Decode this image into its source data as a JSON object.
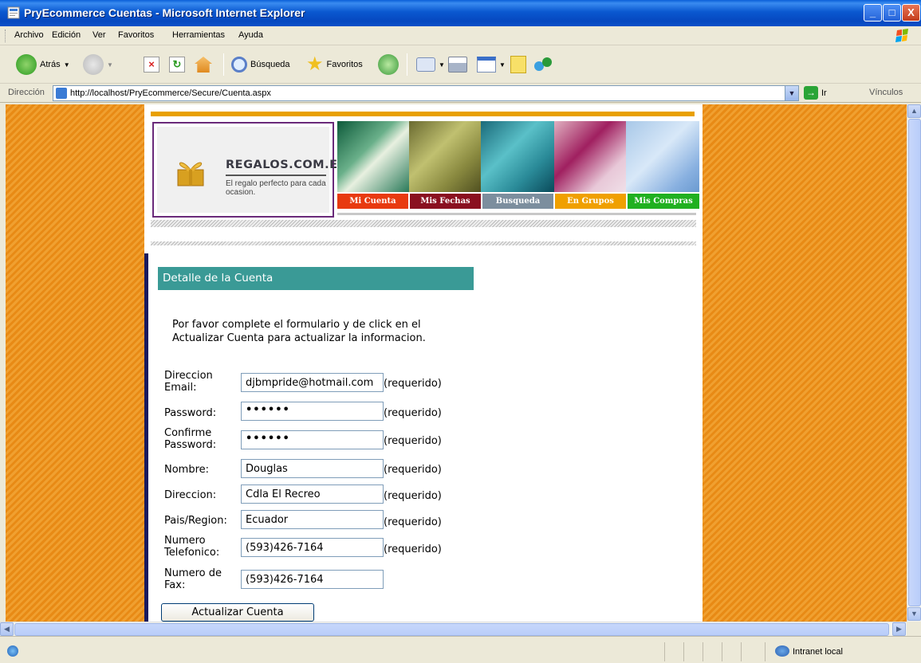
{
  "window": {
    "title": "PryEcommerce Cuentas - Microsoft Internet Explorer",
    "minimize_label": "_",
    "maximize_label": "□",
    "close_label": "X"
  },
  "menu": [
    "Archivo",
    "Edición",
    "Ver",
    "Favoritos",
    "Herramientas",
    "Ayuda"
  ],
  "toolbar": {
    "back_label": "Atrás",
    "search_label": "Búsqueda",
    "favorites_label": "Favoritos"
  },
  "address": {
    "label": "Dirección",
    "url": "http://localhost/PryEcommerce/Secure/Cuenta.aspx",
    "go_label": "Ir",
    "links_label": "Vínculos"
  },
  "site": {
    "brand": "REGALOS.COM.EC",
    "tagline": "El regalo perfecto para cada ocasion.",
    "nav": [
      {
        "label": "Mi Cuenta",
        "color": "#e83a10"
      },
      {
        "label": "Mis Fechas",
        "color": "#8a1020"
      },
      {
        "label": "Busqueda",
        "color": "#7c8e9e"
      },
      {
        "label": "En Grupos",
        "color": "#f0a000"
      },
      {
        "label": "Mis Compras",
        "color": "#20b020"
      }
    ]
  },
  "form": {
    "header": "Detalle de la Cuenta",
    "intro": "Por favor complete el formulario y de click en el Actualizar Cuenta para actualizar la informacion.",
    "required_label": "(requerido)",
    "fields": [
      {
        "label": "Direccion Email:",
        "value": "djbmpride@hotmail.com",
        "required": true
      },
      {
        "label": "Password:",
        "value": "••••••",
        "required": true
      },
      {
        "label": "Confirme Password:",
        "value": "••••••",
        "required": true
      },
      {
        "label": "Nombre:",
        "value": "Douglas",
        "required": true
      },
      {
        "label": "Direccion:",
        "value": "Cdla El Recreo",
        "required": true
      },
      {
        "label": "Pais/Region:",
        "value": "Ecuador",
        "required": true
      },
      {
        "label": "Numero Telefonico:",
        "value": "(593)426-7164",
        "required": true
      },
      {
        "label": "Numero de Fax:",
        "value": "(593)426-7164",
        "required": false
      }
    ],
    "submit_label": "Actualizar Cuenta"
  },
  "status": {
    "zone": "Intranet local"
  }
}
